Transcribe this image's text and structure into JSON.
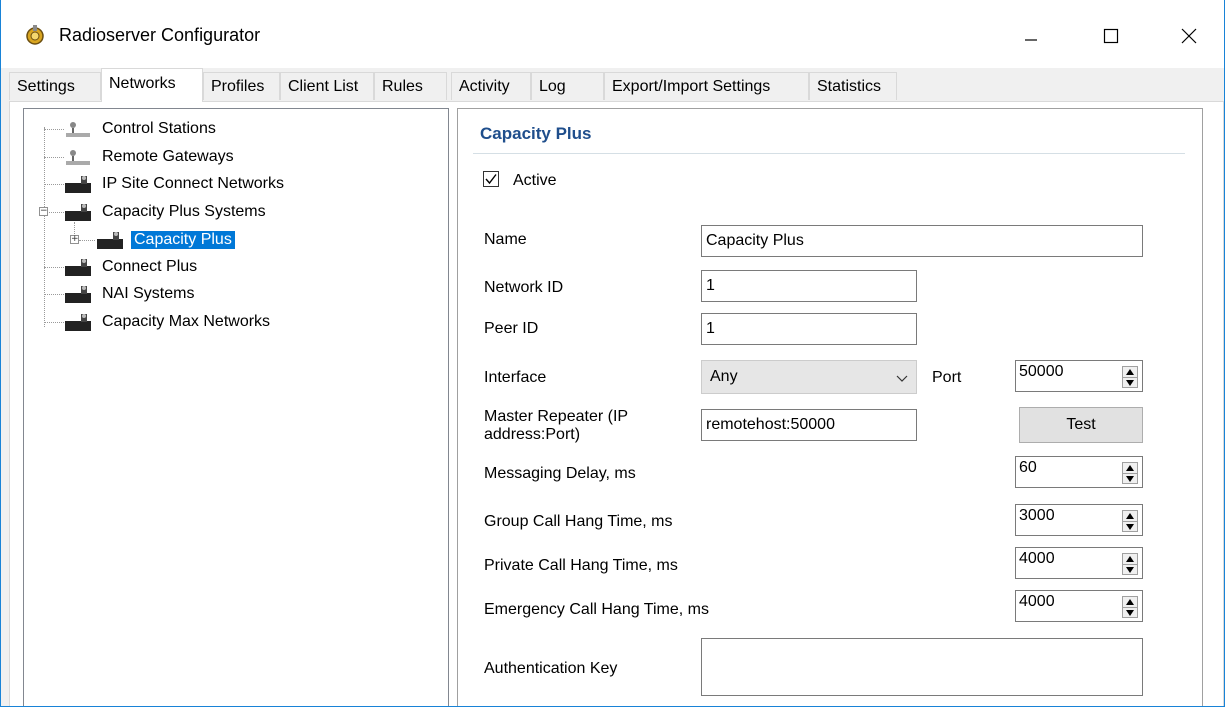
{
  "window": {
    "title": "Radioserver Configurator"
  },
  "tabs": [
    "Settings",
    "Networks",
    "Profiles",
    "Client List",
    "Rules",
    "Activity",
    "Log",
    "Export/Import Settings",
    "Statistics"
  ],
  "tree": {
    "items": [
      "Control Stations",
      "Remote Gateways",
      "IP Site Connect Networks",
      "Capacity Plus Systems",
      "Capacity Plus",
      "Connect Plus",
      "NAI Systems",
      "Capacity Max Networks"
    ]
  },
  "form": {
    "group_title": "Capacity Plus",
    "active_label": "Active",
    "active_checked": true,
    "name_label": "Name",
    "name_value": "Capacity Plus",
    "network_id_label": "Network ID",
    "network_id_value": "1",
    "peer_id_label": "Peer ID",
    "peer_id_value": "1",
    "interface_label": "Interface",
    "interface_value": "Any",
    "port_label": "Port",
    "port_value": "50000",
    "master_label_line1": "Master Repeater (IP",
    "master_label_line2": "address:Port)",
    "master_value": "remotehost:50000",
    "test_label": "Test",
    "messaging_delay_label": "Messaging Delay, ms",
    "messaging_delay_value": "60",
    "group_hang_label": "Group Call Hang Time, ms",
    "group_hang_value": "3000",
    "private_hang_label": "Private Call Hang Time, ms",
    "private_hang_value": "4000",
    "emergency_hang_label": "Emergency Call Hang Time, ms",
    "emergency_hang_value": "4000",
    "auth_key_label": "Authentication Key",
    "auth_key_value": ""
  },
  "colors": {
    "selection": "#0078d7",
    "group_title": "#1f4e8c",
    "window_border": "#1883d7"
  }
}
